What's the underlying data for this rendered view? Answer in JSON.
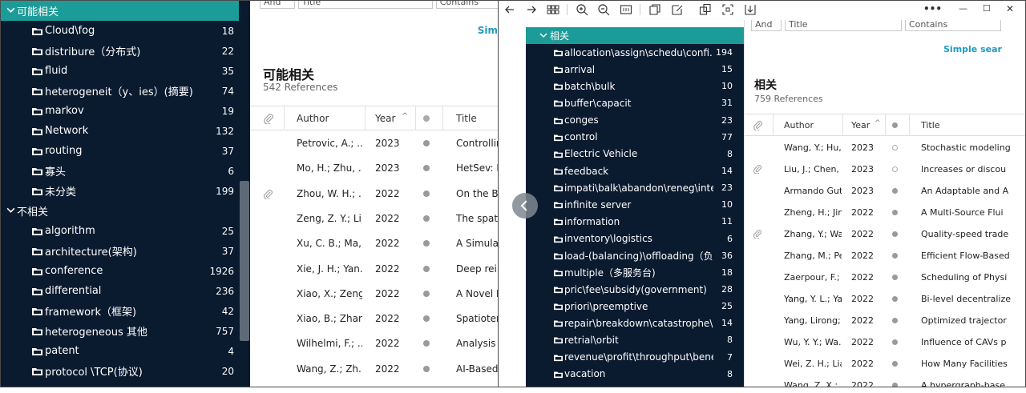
{
  "left": {
    "groups": [
      {
        "label": "可能相关",
        "selected": true,
        "items": [
          {
            "label": "Cloud\\fog",
            "count": "18"
          },
          {
            "label": "distribure（分布式)",
            "count": "22"
          },
          {
            "label": "fluid",
            "count": "35"
          },
          {
            "label": "heterogeneit（y、ies）(摘要)",
            "count": "74"
          },
          {
            "label": "markov",
            "count": "19"
          },
          {
            "label": "Network",
            "count": "132"
          },
          {
            "label": "routing",
            "count": "37"
          },
          {
            "label": "寡头",
            "count": "6"
          },
          {
            "label": "未分类",
            "count": "199"
          }
        ]
      },
      {
        "label": "不相关",
        "selected": false,
        "items": [
          {
            "label": "algorithm",
            "count": "25"
          },
          {
            "label": "architecture(架构)",
            "count": "37"
          },
          {
            "label": "conference",
            "count": "1926"
          },
          {
            "label": "differential",
            "count": "236"
          },
          {
            "label": "framework（框架)",
            "count": "42"
          },
          {
            "label": "heterogeneous 其他",
            "count": "757"
          },
          {
            "label": "patent",
            "count": "4"
          },
          {
            "label": "protocol \\TCP(协议)",
            "count": "20"
          }
        ]
      }
    ],
    "search": {
      "op": "And",
      "field": "Title",
      "cond": "Contains",
      "simple_search": "Sim"
    },
    "collection": {
      "title": "可能相关",
      "subtitle": "542 References"
    },
    "columns": {
      "author": "Author",
      "year": "Year",
      "title": "Title"
    },
    "rows": [
      {
        "author": "Petrovic, A.; ...",
        "year": "2023",
        "title": "Controllin",
        "attach": false
      },
      {
        "author": "Mo, H.; Zhu, ...",
        "year": "2023",
        "title": "HetSev: E",
        "attach": false
      },
      {
        "author": "Zhou, W. H.; ...",
        "year": "2022",
        "title": "On the Be",
        "attach": true
      },
      {
        "author": "Zeng, Z. Y.; Li,...",
        "year": "2022",
        "title": "The spati",
        "attach": false
      },
      {
        "author": "Xu, C. B.; Ma, ...",
        "year": "2022",
        "title": "A Simulat",
        "attach": false
      },
      {
        "author": "Xie, J. H.; Yan...",
        "year": "2022",
        "title": "Deep rein",
        "attach": false
      },
      {
        "author": "Xiao, X.; Zeng...",
        "year": "2022",
        "title": "A Novel D",
        "attach": false
      },
      {
        "author": "Xiao, B.; Zhan...",
        "year": "2022",
        "title": "Spatioten",
        "attach": false
      },
      {
        "author": "Wilhelmi, F.; ...",
        "year": "2022",
        "title": "Analysis a",
        "attach": false
      },
      {
        "author": "Wang, Z.; Zh...",
        "year": "2022",
        "title": "AI-Based",
        "attach": false
      }
    ]
  },
  "right": {
    "group": {
      "label": "相关"
    },
    "items": [
      {
        "label": "allocation\\assign\\schedu\\confi...",
        "count": "194"
      },
      {
        "label": "arrival",
        "count": "15"
      },
      {
        "label": "batch\\bulk",
        "count": "10"
      },
      {
        "label": "buffer\\capacit",
        "count": "31"
      },
      {
        "label": "conges",
        "count": "23"
      },
      {
        "label": "control",
        "count": "77"
      },
      {
        "label": "Electric Vehicle",
        "count": "8"
      },
      {
        "label": "feedback",
        "count": "14"
      },
      {
        "label": "impati\\balk\\abandon\\reneg\\inte...",
        "count": "23"
      },
      {
        "label": "infinite server",
        "count": "10"
      },
      {
        "label": "information",
        "count": "11"
      },
      {
        "label": "inventory\\logistics",
        "count": "6"
      },
      {
        "label": "load-(balancing)\\offloading（负...",
        "count": "36"
      },
      {
        "label": "multiple（多服务台)",
        "count": "18"
      },
      {
        "label": "pric\\fee\\subsidy(government)",
        "count": "28"
      },
      {
        "label": "priori\\preemptive",
        "count": "25"
      },
      {
        "label": "repair\\breakdown\\catastrophe\\c...",
        "count": "14"
      },
      {
        "label": "retrial\\orbit",
        "count": "8"
      },
      {
        "label": "revenue\\profit\\throughput\\benefit",
        "count": "7"
      },
      {
        "label": "vacation",
        "count": "8"
      }
    ],
    "search": {
      "op": "And",
      "field": "Title",
      "cond": "Contains",
      "simple_search": "Simple sear"
    },
    "collection": {
      "title": "相关",
      "subtitle": "759 References"
    },
    "columns": {
      "author": "Author",
      "year": "Year",
      "title": "Title"
    },
    "rows": [
      {
        "author": "Wang, Y.; Hu,...",
        "year": "2023",
        "title": "Stochastic modeling",
        "attach": false,
        "hollow": true
      },
      {
        "author": "Liu, J.; Chen, J...",
        "year": "2023",
        "title": "Increases or discou",
        "attach": true,
        "hollow": true
      },
      {
        "author": "Armando Gut...",
        "year": "2023",
        "title": "An Adaptable and A",
        "attach": false,
        "hollow": false
      },
      {
        "author": "Zheng, H.; Jin...",
        "year": "2022",
        "title": "A Multi-Source Flui",
        "attach": false,
        "hollow": false
      },
      {
        "author": "Zhang, Y.; Wa...",
        "year": "2022",
        "title": "Quality-speed trade",
        "attach": true,
        "hollow": false
      },
      {
        "author": "Zhang, M.; Pe...",
        "year": "2022",
        "title": "Efficient Flow-Based",
        "attach": false,
        "hollow": false
      },
      {
        "author": "Zaerpour, F.; ...",
        "year": "2022",
        "title": "Scheduling of Physi",
        "attach": false,
        "hollow": false
      },
      {
        "author": "Yang, Y. L.; Ya...",
        "year": "2022",
        "title": "Bi-level decentralize",
        "attach": false,
        "hollow": false
      },
      {
        "author": "Yang, Lirong; ...",
        "year": "2022",
        "title": "Optimized trajector",
        "attach": false,
        "hollow": false
      },
      {
        "author": "Wu, Y. Y.; Wa...",
        "year": "2022",
        "title": "Influence of CAVs p",
        "attach": false,
        "hollow": false
      },
      {
        "author": "Wei, Z. H.; Lia...",
        "year": "2022",
        "title": "How Many Facilities",
        "attach": false,
        "hollow": false
      },
      {
        "author": "Wang, Z. X.;...",
        "year": "2022",
        "title": "A hypergraph-base",
        "attach": false,
        "hollow": false
      }
    ],
    "toolbar_icons": [
      "back-arrow-icon",
      "forward-arrow-icon",
      "grid-icon",
      "zoom-in-icon",
      "zoom-out-icon",
      "fit-page-icon",
      "open-icon",
      "edit-icon",
      "copy-icon",
      "crop-icon",
      "download-icon"
    ],
    "window": {
      "more": "•••",
      "minimize": "—",
      "maximize": "☐",
      "close": "✕"
    }
  },
  "colors": {
    "sidebar_bg": "#0a1a2f",
    "selected_teal": "#1c9c98",
    "link_blue": "#1f9bc0"
  }
}
